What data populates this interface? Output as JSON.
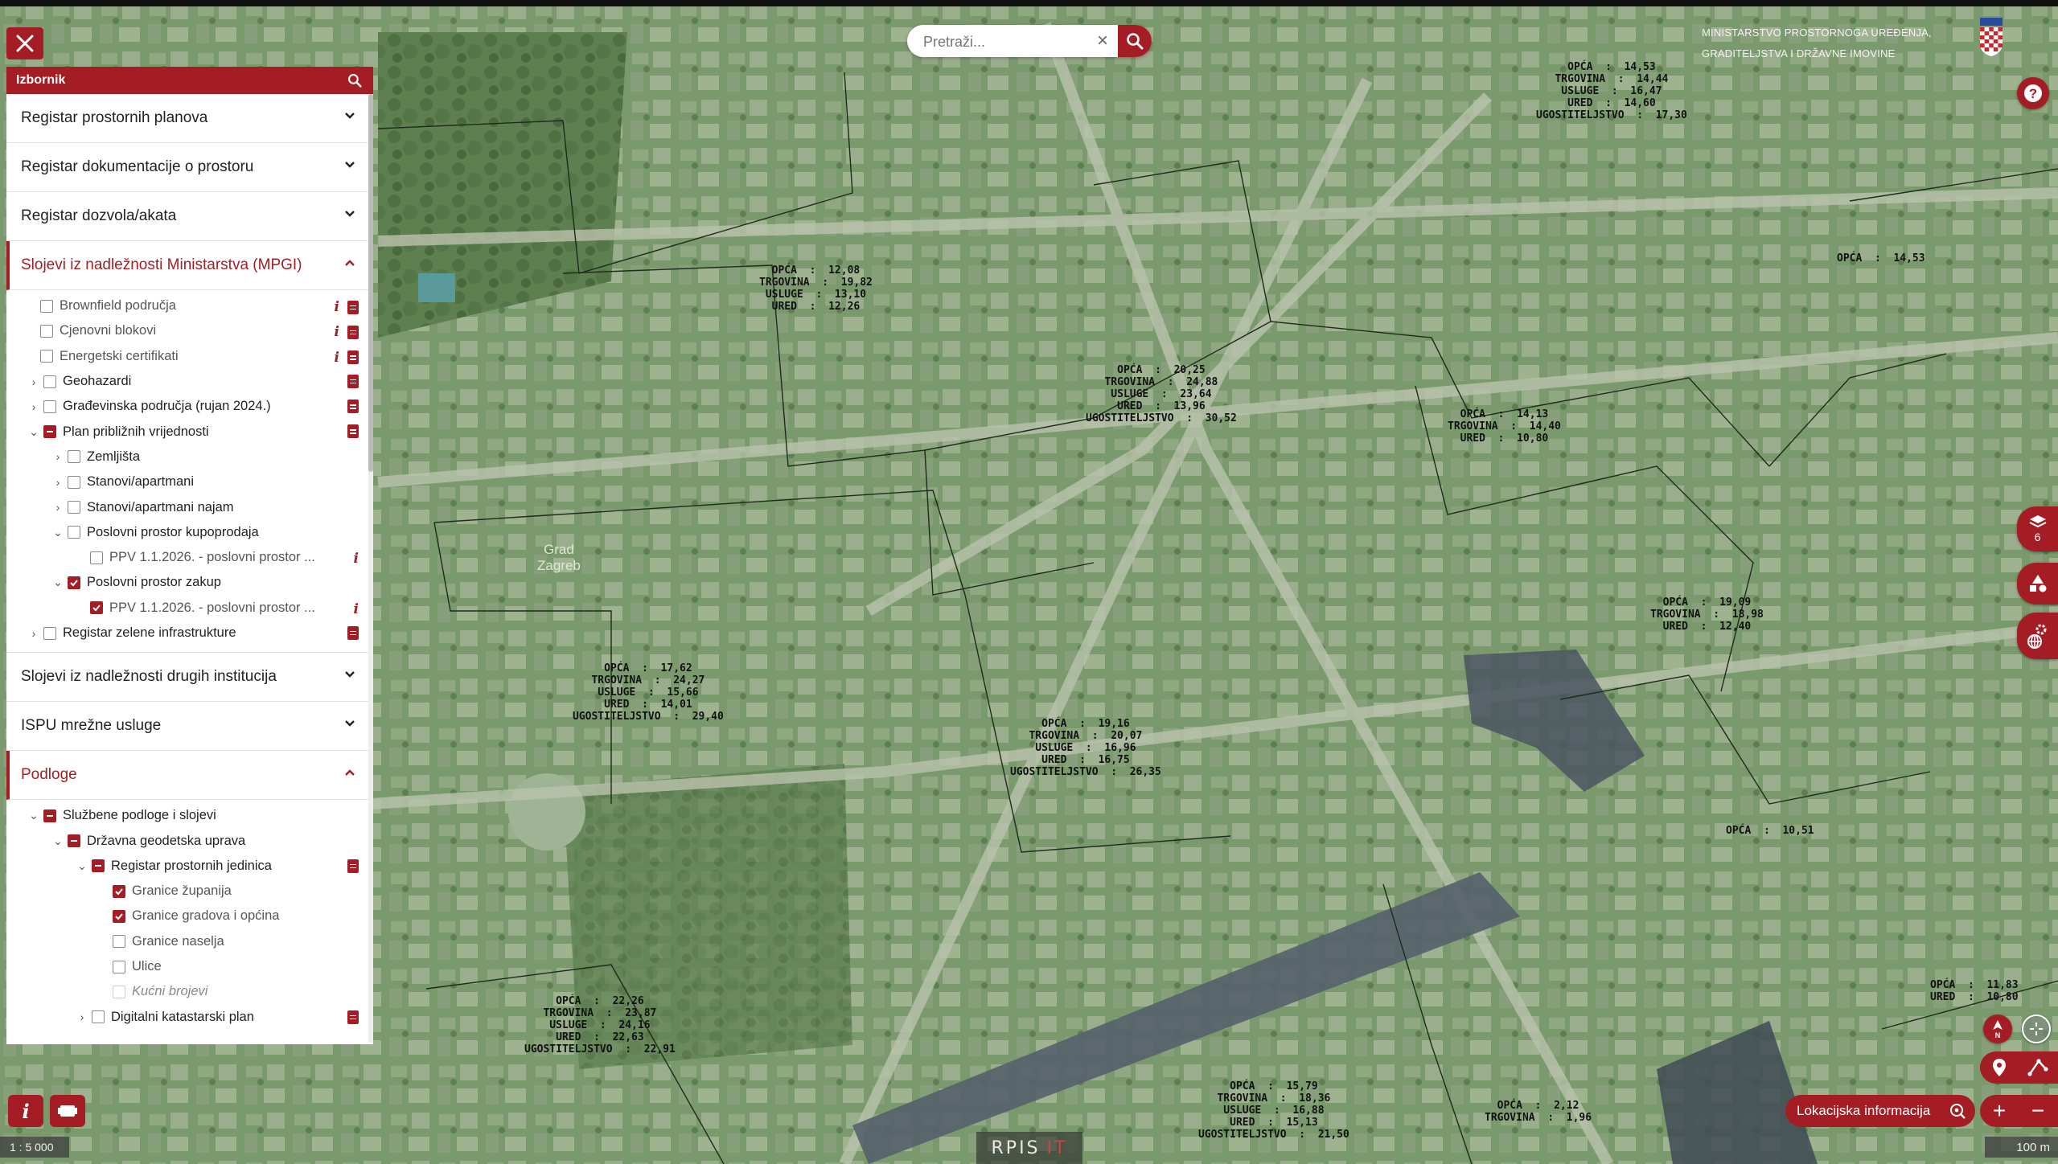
{
  "search": {
    "placeholder": "Pretraži..."
  },
  "ministry": {
    "line1": "MINISTARSTVO PROSTORNOGA UREĐENJA,",
    "line2": "GRADITELJSTVA I DRŽAVNE IMOVINE"
  },
  "sidebar": {
    "title": "Izbornik",
    "sections": {
      "s1": "Registar prostornih planova",
      "s2": "Registar dokumentacije o prostoru",
      "s3": "Registar dozvola/akata",
      "s4": "Slojevi iz nadležnosti Ministarstva (MPGI)",
      "s5": "Slojevi iz nadležnosti drugih institucija",
      "s6": "ISPU mrežne usluge",
      "s7": "Podloge"
    },
    "mpgi": {
      "brownfield": "Brownfield područja",
      "cjenovni": "Cjenovni blokovi",
      "energetski": "Energetski certifikati",
      "geohazardi": "Geohazardi",
      "gradjevinska": "Građevinska područja (rujan 2024.)",
      "plan": "Plan približnih vrijednosti",
      "zemljista": "Zemljišta",
      "stanovi": "Stanovi/apartmani",
      "najam": "Stanovi/apartmani najam",
      "kupoprodaja": "Poslovni prostor kupoprodaja",
      "ppv1": "PPV 1.1.2026. - poslovni prostor ...",
      "zakup": "Poslovni prostor zakup",
      "ppv2": "PPV 1.1.2026. - poslovni prostor ...",
      "zelena": "Registar zelene infrastrukture"
    },
    "podloge": {
      "sluzbene": "Službene podloge i slojevi",
      "dgu": "Državna geodetska uprava",
      "rpj": "Registar prostornih jedinica",
      "zupanije": "Granice županija",
      "gradovi": "Granice gradova i općina",
      "naselja": "Granice naselja",
      "ulice": "Ulice",
      "brojevi": "Kućni brojevi",
      "katastar": "Digitalni katastarski plan"
    }
  },
  "map_labels": [
    {
      "id": "l1",
      "text": "OPĆA  :  14,53\nTRGOVINA  :  14,44\nUSLUGE  :  16,47\nURED  :  14,60\nUGOSTITELJSTVO  :  17,30"
    },
    {
      "id": "l2",
      "text": "OPĆA  :  12,08\nTRGOVINA  :  19,82\nUSLUGE  :  13,10\nURED  :  12,26"
    },
    {
      "id": "l3",
      "text": "OPĆA  :  14,53"
    },
    {
      "id": "l4",
      "text": "OPĆA  :  20,25\nTRGOVINA  :  24,88\nUSLUGE  :  23,64\nURED  :  13,96\nUGOSTITELJSTVO  :  30,52"
    },
    {
      "id": "l5",
      "text": "OPĆA  :  14,13\nTRGOVINA  :  14,40\nURED  :  10,80"
    },
    {
      "id": "l6",
      "text": "OPĆA  :  19,09\nTRGOVINA  :  18,98\nURED  :  12,40"
    },
    {
      "id": "l7",
      "text": "OPĆA  :  17,62\nTRGOVINA  :  24,27\nUSLUGE  :  15,66\nURED  :  14,01\nUGOSTITELJSTVO  :  29,40"
    },
    {
      "id": "l8",
      "text": "OPĆA  :  19,16\nTRGOVINA  :  20,07\nUSLUGE  :  16,96\nURED  :  16,75\nUGOSTITELJSTVO  :  26,35"
    },
    {
      "id": "l9",
      "text": "OPĆA  :  10,51"
    },
    {
      "id": "l10",
      "text": "OPĆA  :  11,83\nURED  :  10,80"
    },
    {
      "id": "l11",
      "text": "OPĆA  :  22,26\nTRGOVINA  :  23,87\nUSLUGE  :  24,16\nURED  :  22,63\nUGOSTITELJSTVO  :  22,91"
    },
    {
      "id": "l12",
      "text": "OPĆA  :  15,79\nTRGOVINA  :  18,36\nUSLUGE  :  16,88\nURED  :  15,13\nUGOSTITELJSTVO  :  21,50"
    },
    {
      "id": "l13",
      "text": "OPĆA  :  2,12\nTRGOVINA  :  1,96"
    }
  ],
  "place_label": "Grad\nZagreb",
  "layers_count": "6",
  "location_info": "Lokacijska informacija",
  "scale": {
    "ratio": "1 : 5 000",
    "distance": "100 m"
  },
  "logo": {
    "main": "RPIS",
    "suffix": "IT"
  },
  "colors": {
    "accent": "#a51d24"
  }
}
